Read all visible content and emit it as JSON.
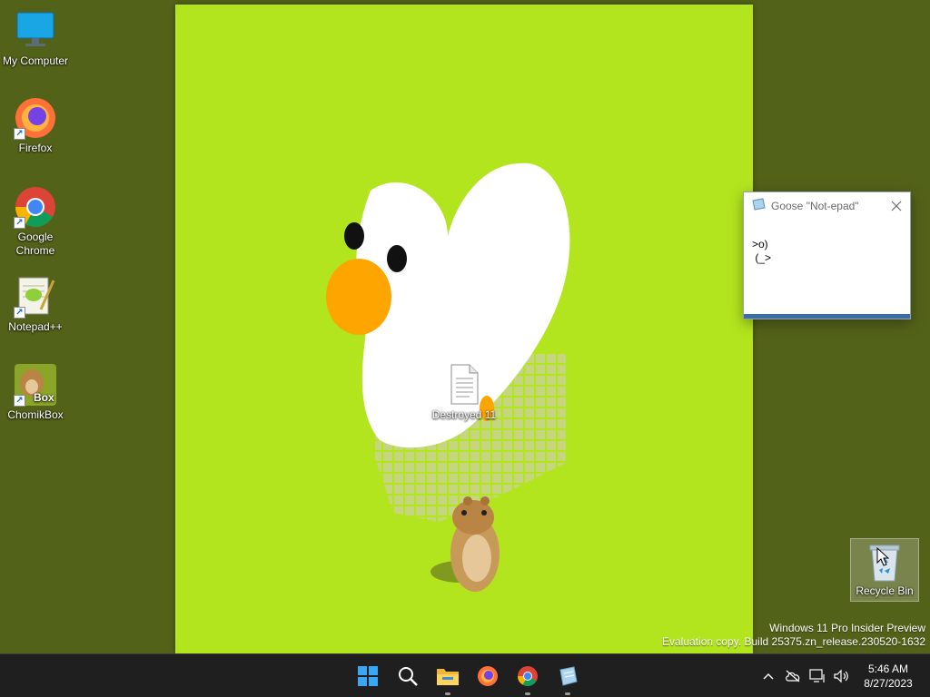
{
  "desktop": {
    "icons": [
      {
        "label": "My Computer"
      },
      {
        "label": "Firefox"
      },
      {
        "label": "Google Chrome"
      },
      {
        "label": "Notepad++"
      },
      {
        "label": "ChomikBox"
      }
    ],
    "recycle_bin": {
      "label": "Recycle Bin"
    },
    "file_on_wallpaper": {
      "label": "Destroyed 11"
    }
  },
  "goose_window": {
    "title": "Goose \"Not-epad\"",
    "content_line1": ">o)",
    "content_line2": " (_>"
  },
  "watermark": {
    "line1": "Windows 11 Pro Insider Preview",
    "line2": "Evaluation copy. Build 25375.zn_release.230520-1632"
  },
  "taskbar": {
    "apps": [
      "start-icon",
      "search-icon",
      "file-explorer-icon",
      "firefox-icon",
      "chrome-icon",
      "notepad-icon"
    ],
    "time": "5:46 AM",
    "date": "8/27/2023"
  },
  "colors": {
    "wallpaper_outer": "#536219",
    "wallpaper_panel": "#b3e51e",
    "taskbar": "#1f1f1f"
  }
}
